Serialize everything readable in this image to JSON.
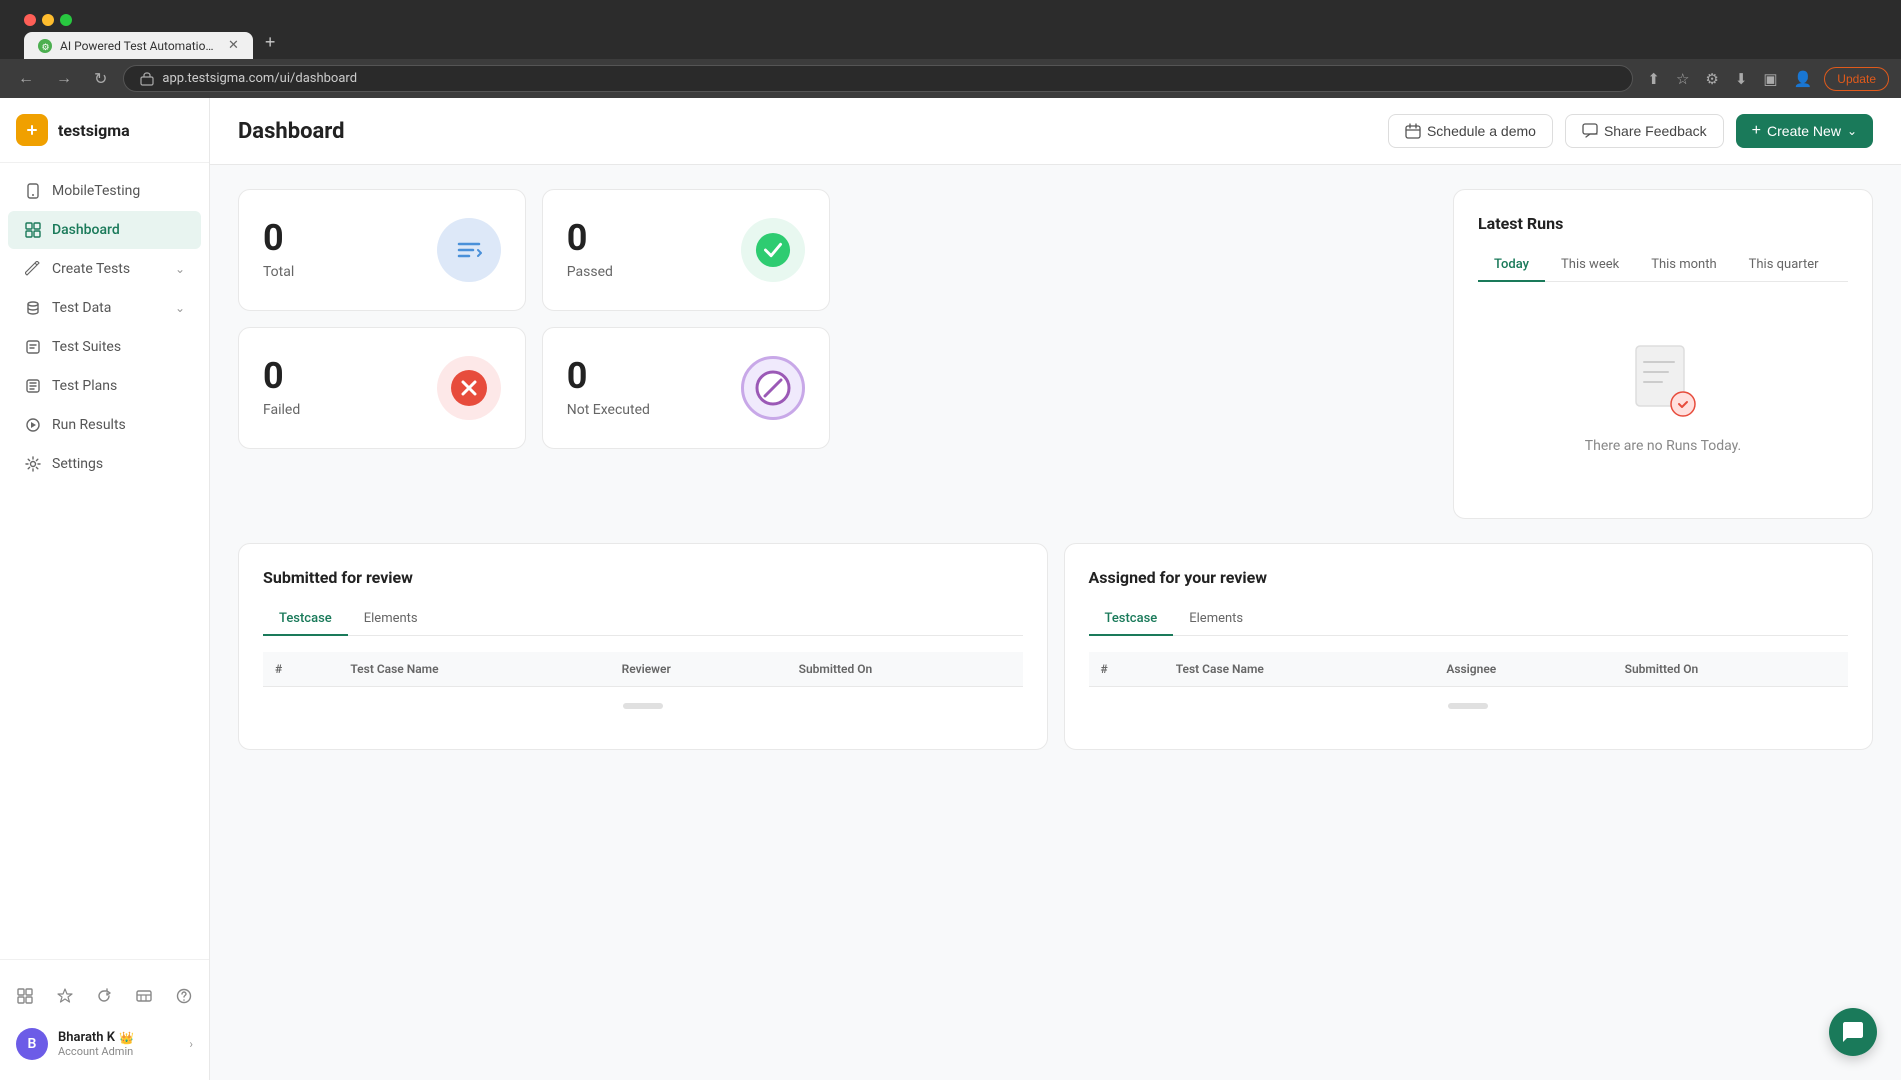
{
  "browser": {
    "tab_title": "AI Powered Test Automation Pl",
    "tab_favicon": "⚙",
    "url": "app.testsigma.com/ui/dashboard",
    "update_label": "Update"
  },
  "app": {
    "logo_text": "testsigma",
    "logo_icon": "⚙"
  },
  "sidebar": {
    "items": [
      {
        "id": "mobile-testing",
        "label": "MobileTesting",
        "icon": "📱",
        "has_chevron": false
      },
      {
        "id": "dashboard",
        "label": "Dashboard",
        "icon": "🏠",
        "active": true,
        "has_chevron": false
      },
      {
        "id": "create-tests",
        "label": "Create Tests",
        "icon": "✏",
        "has_chevron": true
      },
      {
        "id": "test-data",
        "label": "Test Data",
        "icon": "🗄",
        "has_chevron": true
      },
      {
        "id": "test-suites",
        "label": "Test Suites",
        "icon": "📋",
        "has_chevron": false
      },
      {
        "id": "test-plans",
        "label": "Test Plans",
        "icon": "📅",
        "has_chevron": false
      },
      {
        "id": "run-results",
        "label": "Run Results",
        "icon": "▶",
        "has_chevron": false
      },
      {
        "id": "settings",
        "label": "Settings",
        "icon": "⚙",
        "has_chevron": false
      }
    ],
    "bottom_icons": [
      "grid",
      "star",
      "refresh",
      "table",
      "help"
    ],
    "user": {
      "initial": "B",
      "name": "Bharath K",
      "role": "Account Admin",
      "crown": "👑"
    }
  },
  "header": {
    "title": "Dashboard",
    "schedule_demo_label": "Schedule a demo",
    "share_feedback_label": "Share Feedback",
    "create_new_label": "Create New"
  },
  "stats": {
    "total": {
      "number": "0",
      "label": "Total"
    },
    "passed": {
      "number": "0",
      "label": "Passed"
    },
    "failed": {
      "number": "0",
      "label": "Failed"
    },
    "not_executed": {
      "number": "0",
      "label": "Not Executed"
    }
  },
  "latest_runs": {
    "title": "Latest Runs",
    "tabs": [
      {
        "id": "today",
        "label": "Today",
        "active": true
      },
      {
        "id": "this-week",
        "label": "This week"
      },
      {
        "id": "this-month",
        "label": "This month"
      },
      {
        "id": "this-quarter",
        "label": "This quarter"
      }
    ],
    "empty_message": "There are no Runs Today."
  },
  "submitted_review": {
    "title": "Submitted for review",
    "tabs": [
      {
        "id": "testcase",
        "label": "Testcase",
        "active": true
      },
      {
        "id": "elements",
        "label": "Elements"
      }
    ],
    "columns": [
      "#",
      "Test Case Name",
      "Reviewer",
      "Submitted On"
    ]
  },
  "assigned_review": {
    "title": "Assigned for your review",
    "tabs": [
      {
        "id": "testcase",
        "label": "Testcase",
        "active": true
      },
      {
        "id": "elements",
        "label": "Elements"
      }
    ],
    "columns": [
      "#",
      "Test Case Name",
      "Assignee",
      "Submitted On"
    ]
  },
  "chat_fab": {
    "icon": "💬"
  }
}
